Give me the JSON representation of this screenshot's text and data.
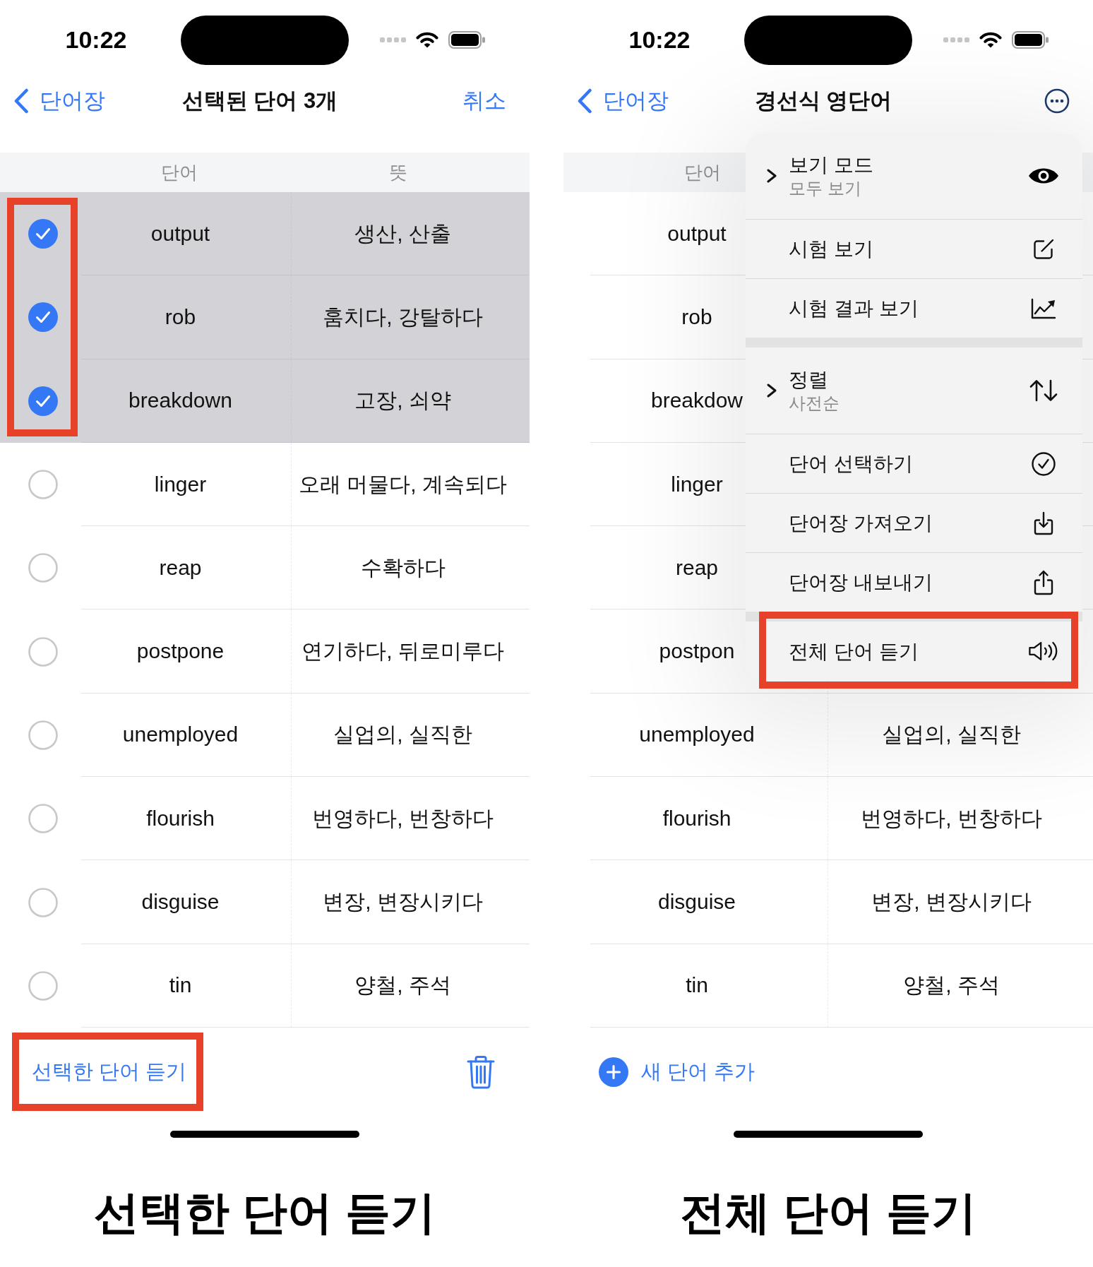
{
  "screens": [
    {
      "status_bar": {
        "time": "10:22"
      },
      "nav_bar": {
        "back_label": "단어장",
        "title": "선택된 단어 3개",
        "action": {
          "kind": "text",
          "label": "취소"
        }
      },
      "table": {
        "columns": [
          "단어",
          "뜻"
        ],
        "checkboxes": true,
        "checkbox_column_highlighted": true,
        "rows": [
          {
            "word": "output",
            "meaning": "생산, 산출",
            "selected": true
          },
          {
            "word": "rob",
            "meaning": "훔치다, 강탈하다",
            "selected": true
          },
          {
            "word": "breakdown",
            "meaning": "고장, 쇠약",
            "selected": true
          },
          {
            "word": "linger",
            "meaning": "오래 머물다, 계속되다",
            "selected": false
          },
          {
            "word": "reap",
            "meaning": "수확하다",
            "selected": false
          },
          {
            "word": "postpone",
            "meaning": "연기하다, 뒤로미루다",
            "selected": false
          },
          {
            "word": "unemployed",
            "meaning": "실업의, 실직한",
            "selected": false
          },
          {
            "word": "flourish",
            "meaning": "번영하다, 번창하다",
            "selected": false
          },
          {
            "word": "disguise",
            "meaning": "변장, 변장시키다",
            "selected": false
          },
          {
            "word": "tin",
            "meaning": "양철, 주석",
            "selected": false
          }
        ]
      },
      "toolbar": {
        "kind": "selection",
        "button": {
          "label": "선택한 단어 듣기",
          "highlighted": true
        }
      },
      "caption": "선택한 단어 듣기"
    },
    {
      "status_bar": {
        "time": "10:22"
      },
      "nav_bar": {
        "back_label": "단어장",
        "title": "경선식 영단어",
        "action": {
          "kind": "more"
        }
      },
      "table": {
        "columns": [
          "단어"
        ],
        "checkboxes": false,
        "rows": [
          {
            "word": "output"
          },
          {
            "word": "rob"
          },
          {
            "word": "breakdow"
          },
          {
            "word": "linger"
          },
          {
            "word": "reap"
          },
          {
            "word": "postpon"
          },
          {
            "word": "unemployed",
            "meaning": "실업의, 실직한"
          },
          {
            "word": "flourish",
            "meaning": "번영하다, 번창하다"
          },
          {
            "word": "disguise",
            "meaning": "변장, 변장시키다"
          },
          {
            "word": "tin",
            "meaning": "양철, 주석"
          }
        ]
      },
      "menu": {
        "sections": [
          {
            "items": [
              {
                "label": "보기 모드",
                "detail": "모두 보기",
                "submenu": true,
                "highlighted": false
              },
              {
                "label": "시험 보기",
                "submenu": false,
                "highlighted": false
              },
              {
                "label": "시험 결과 보기",
                "submenu": false,
                "highlighted": false
              }
            ]
          },
          {
            "items": [
              {
                "label": "정렬",
                "detail": "사전순",
                "submenu": true,
                "highlighted": false
              },
              {
                "label": "단어 선택하기",
                "submenu": false,
                "highlighted": false
              },
              {
                "label": "단어장 가져오기",
                "submenu": false,
                "highlighted": false
              },
              {
                "label": "단어장 내보내기",
                "submenu": false,
                "highlighted": false
              }
            ]
          },
          {
            "items": [
              {
                "label": "전체 단어 듣기",
                "submenu": false,
                "highlighted": true
              }
            ]
          }
        ]
      },
      "toolbar": {
        "kind": "add",
        "button": {
          "label": "새 단어 추가",
          "highlighted": false
        }
      },
      "caption": "전체 단어 듣기"
    }
  ]
}
